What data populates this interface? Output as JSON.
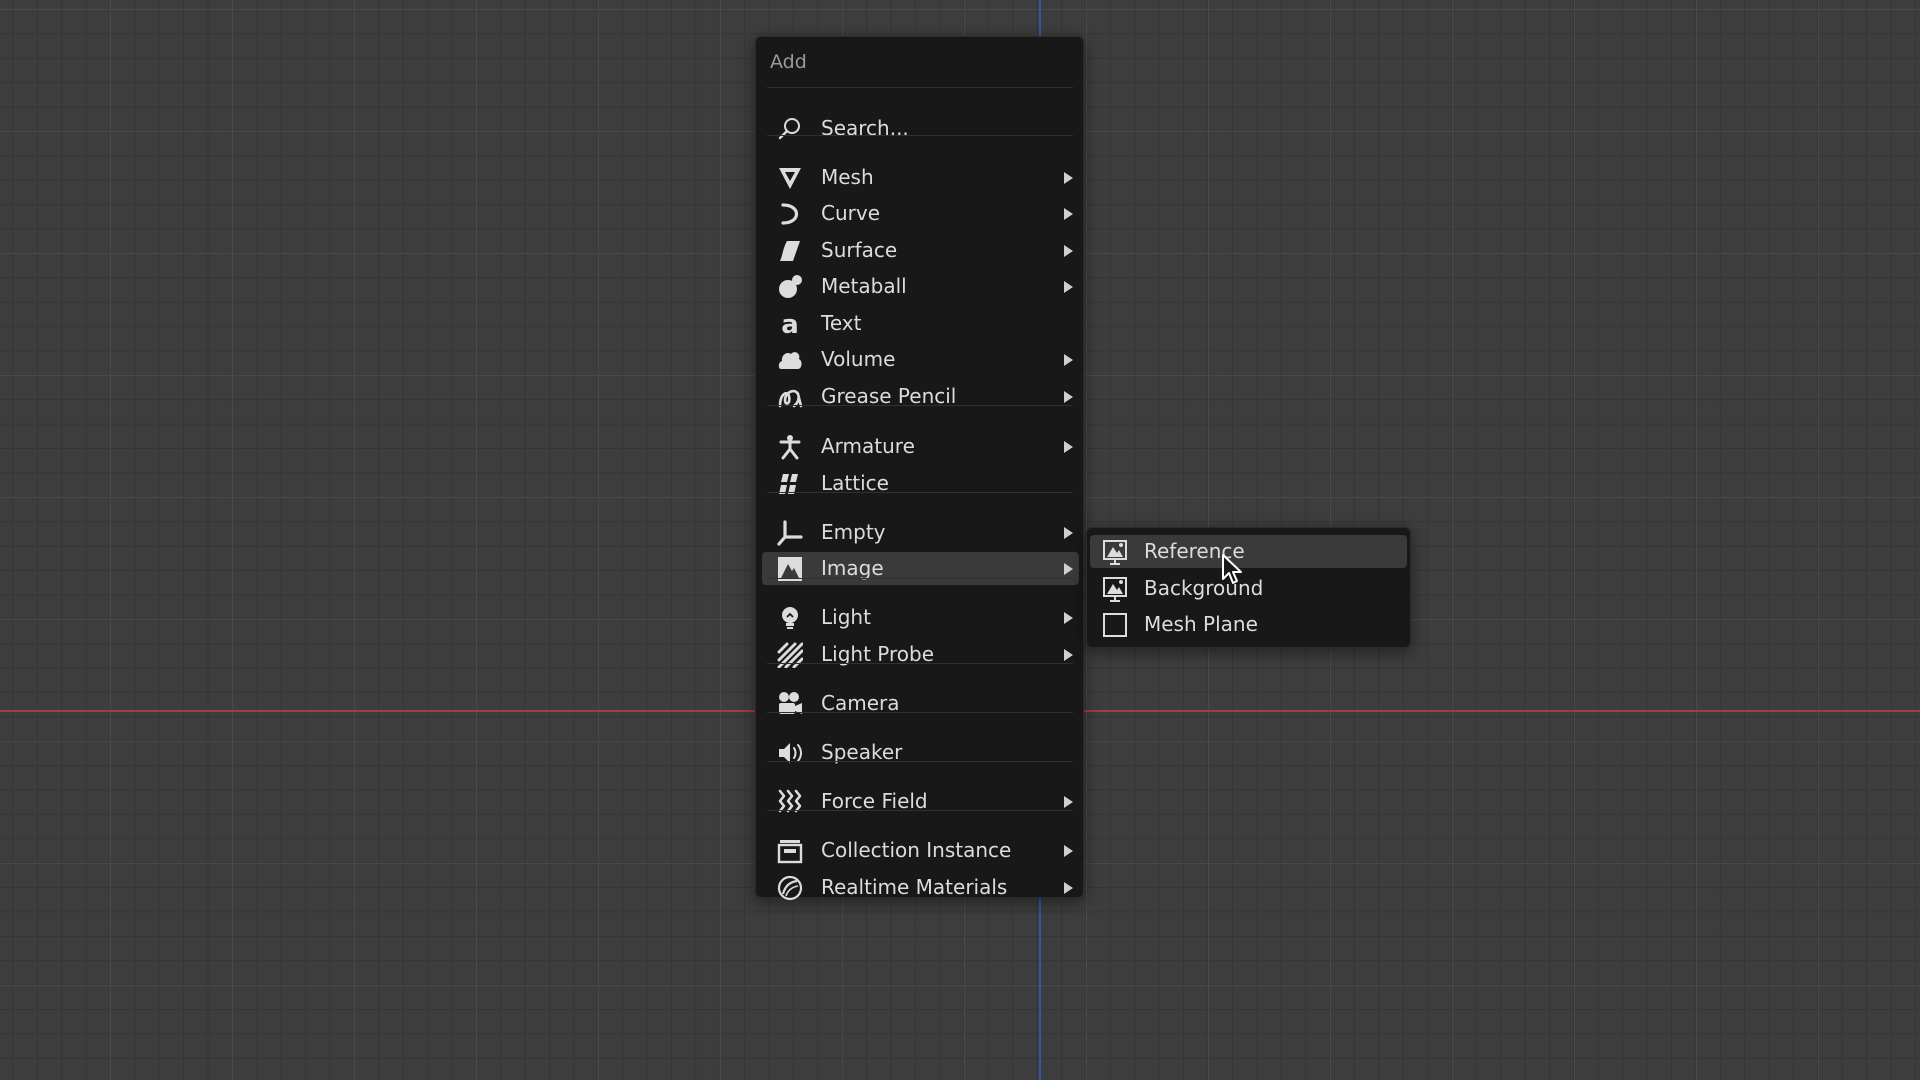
{
  "menu": {
    "title": "Add",
    "search_label": "Search...",
    "items": [
      {
        "label": "Mesh",
        "icon": "mesh-icon",
        "submenu": true
      },
      {
        "label": "Curve",
        "icon": "curve-icon",
        "submenu": true
      },
      {
        "label": "Surface",
        "icon": "surface-icon",
        "submenu": true
      },
      {
        "label": "Metaball",
        "icon": "metaball-icon",
        "submenu": true
      },
      {
        "label": "Text",
        "icon": "text-icon",
        "submenu": false
      },
      {
        "label": "Volume",
        "icon": "volume-icon",
        "submenu": true
      },
      {
        "label": "Grease Pencil",
        "icon": "grease-pencil-icon",
        "submenu": true
      },
      {
        "label": "Armature",
        "icon": "armature-icon",
        "submenu": true
      },
      {
        "label": "Lattice",
        "icon": "lattice-icon",
        "submenu": false
      },
      {
        "label": "Empty",
        "icon": "empty-icon",
        "submenu": true
      },
      {
        "label": "Image",
        "icon": "image-icon",
        "submenu": true,
        "active": true
      },
      {
        "label": "Light",
        "icon": "light-icon",
        "submenu": true
      },
      {
        "label": "Light Probe",
        "icon": "light-probe-icon",
        "submenu": true
      },
      {
        "label": "Camera",
        "icon": "camera-icon",
        "submenu": false
      },
      {
        "label": "Speaker",
        "icon": "speaker-icon",
        "submenu": false
      },
      {
        "label": "Force Field",
        "icon": "force-field-icon",
        "submenu": true
      },
      {
        "label": "Collection Instance",
        "icon": "collection-instance-icon",
        "submenu": true
      },
      {
        "label": "Realtime Materials",
        "icon": "realtime-materials-icon",
        "submenu": true
      }
    ]
  },
  "image_submenu": {
    "items": [
      {
        "label": "Reference",
        "icon": "image-reference-icon",
        "hover": true
      },
      {
        "label": "Background",
        "icon": "image-background-icon"
      },
      {
        "label": "Mesh Plane",
        "icon": "mesh-plane-icon"
      }
    ]
  },
  "colors": {
    "viewport_bg": "#3d3d3d",
    "menu_bg": "#181818",
    "hover_bg": "#3a3a3a",
    "text": "#dcdcdc",
    "axis_y": "#2c5aa8",
    "axis_x": "#a33a45"
  }
}
